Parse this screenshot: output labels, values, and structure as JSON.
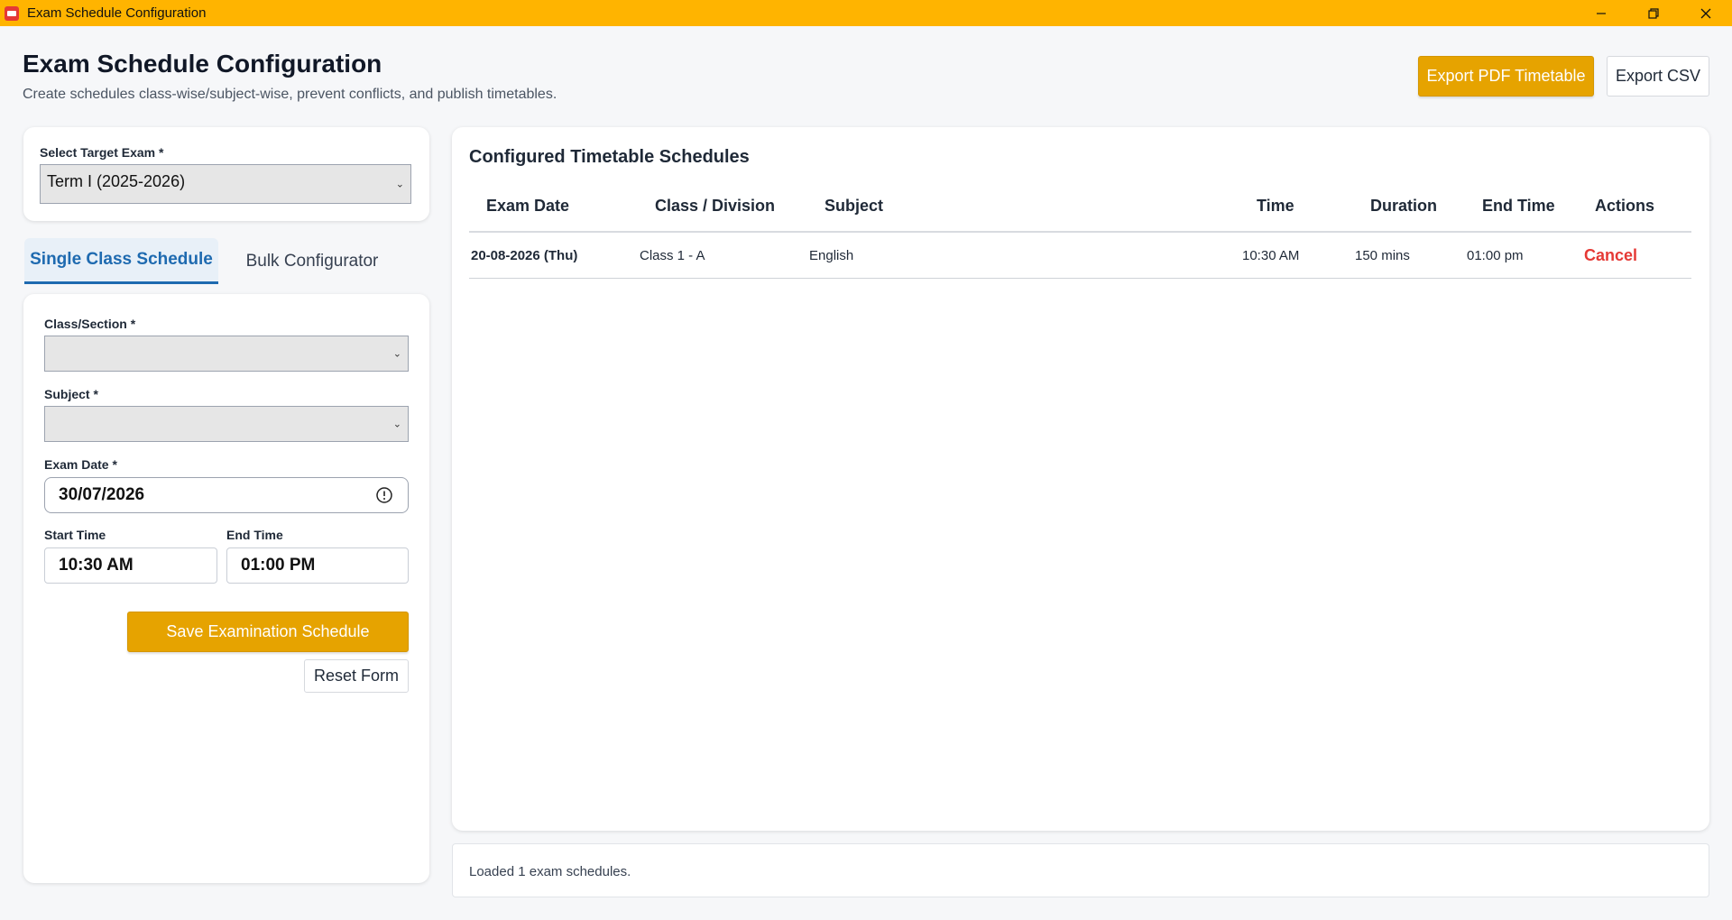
{
  "window": {
    "title": "Exam Schedule Configuration",
    "minimize": "—",
    "restore": "❐",
    "close": "✕"
  },
  "header": {
    "title": "Exam Schedule Configuration",
    "subtitle": "Create schedules class-wise/subject-wise, prevent conflicts, and publish timetables.",
    "export_pdf_label": "Export PDF Timetable",
    "export_csv_label": "Export CSV"
  },
  "exam_select": {
    "label": "Select Target Exam *",
    "value": "Term I (2025-2026)"
  },
  "tabs": [
    {
      "label": "Single Class Schedule",
      "active": true
    },
    {
      "label": "Bulk Configurator",
      "active": false
    }
  ],
  "form": {
    "class_label": "Class/Section *",
    "class_value": "",
    "subject_label": "Subject *",
    "subject_value": "",
    "date_label": "Exam Date *",
    "date_value": "30/07/2026",
    "start_label": "Start Time",
    "start_value": "10:30 AM",
    "end_label": "End Time",
    "end_value": "01:00 PM",
    "save_label": "Save Examination Schedule",
    "reset_label": "Reset Form"
  },
  "table": {
    "title": "Configured Timetable Schedules",
    "columns": [
      "Exam Date",
      "Class / Division",
      "Subject",
      "Time",
      "Duration",
      "End Time",
      "Actions"
    ],
    "rows": [
      {
        "date": "20-08-2026 (Thu)",
        "class": "Class 1 - A",
        "subject": "English",
        "time": "10:30 AM",
        "duration": "150 mins",
        "end_time": "01:00 pm",
        "action": "Cancel"
      }
    ]
  },
  "status": {
    "text": "Loaded 1 exam schedules."
  },
  "colors": {
    "accent": "#ffb400",
    "primary_button": "#e6a300",
    "tab_active": "#1e6ab0",
    "danger": "#e53935"
  }
}
